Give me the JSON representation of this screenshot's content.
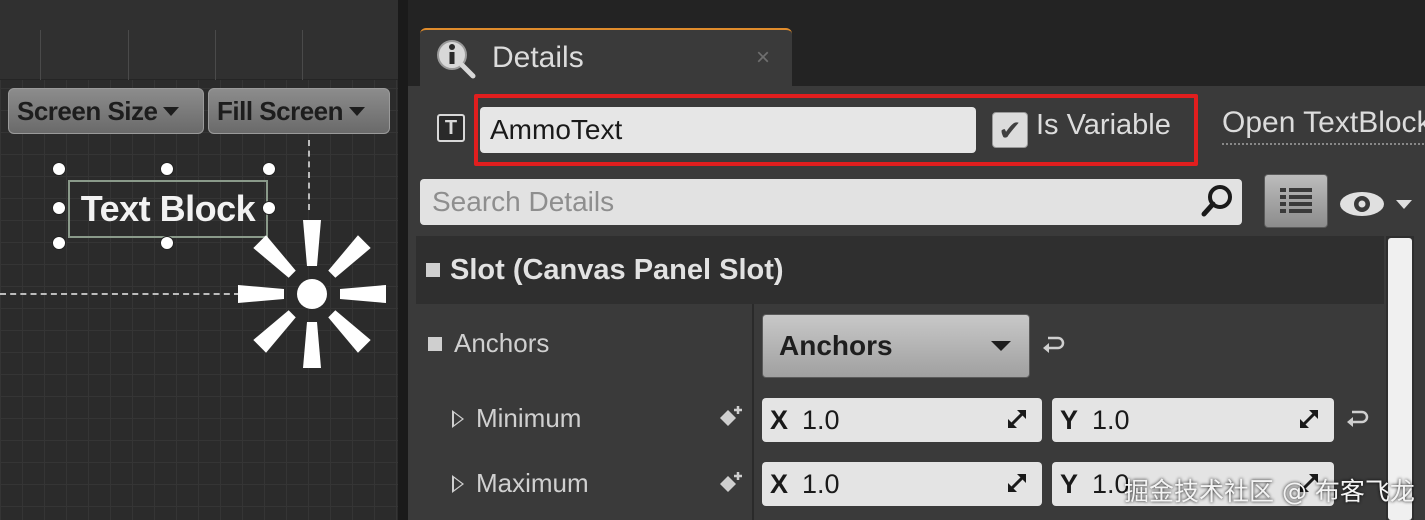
{
  "designer": {
    "screen_size_label": "Screen Size",
    "fill_screen_label": "Fill Screen",
    "widget_label": "Text Block"
  },
  "details_tab": {
    "title": "Details",
    "icon": "info-magnifier-icon",
    "close_glyph": "×"
  },
  "widget_header": {
    "type_icon": "T",
    "name_value": "AmmoText",
    "is_variable_label": "Is Variable",
    "is_variable_checked": true,
    "open_link_label": "Open TextBlock",
    "highlight_color": "#e01e1e"
  },
  "search": {
    "placeholder": "Search Details",
    "icon": "search-icon"
  },
  "toolbar": {
    "view_options_icon": "list-grid-icon",
    "visibility_icon": "eye-icon"
  },
  "slot_section": {
    "title": "Slot (Canvas Panel Slot)"
  },
  "properties": {
    "anchors": {
      "label": "Anchors",
      "dropdown_value": "Anchors"
    },
    "minimum": {
      "label": "Minimum",
      "x_label": "X",
      "x_value": "1.0",
      "y_label": "Y",
      "y_value": "1.0"
    },
    "maximum": {
      "label": "Maximum",
      "x_label": "X",
      "x_value": "1.0",
      "y_label": "Y",
      "y_value": "1.0"
    }
  },
  "watermark": "掘金技术社区 @ 布客飞龙",
  "colors": {
    "tab_accent": "#e08c2c",
    "panel_bg": "#3a3a3a",
    "canvas_bg": "#2b2b2b"
  }
}
